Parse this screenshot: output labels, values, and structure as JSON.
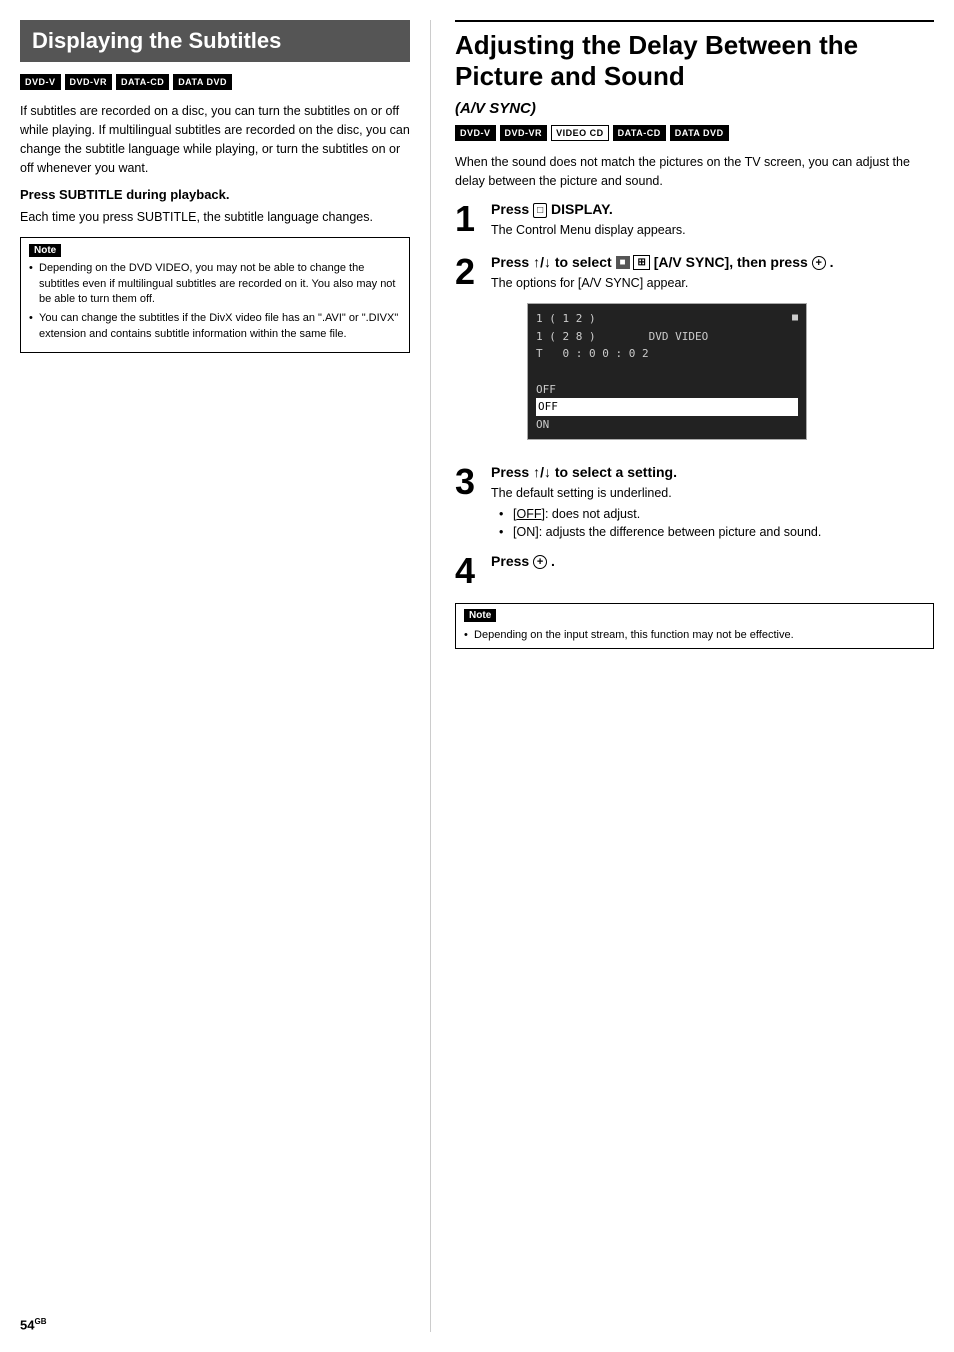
{
  "left": {
    "title": "Displaying the Subtitles",
    "badges": [
      {
        "label": "DVD-V",
        "style": "filled"
      },
      {
        "label": "DVD-VR",
        "style": "filled"
      },
      {
        "label": "DATA-CD",
        "style": "filled"
      },
      {
        "label": "DATA DVD",
        "style": "filled"
      }
    ],
    "intro": "If subtitles are recorded on a disc, you can turn the subtitles on or off while playing. If multilingual subtitles are recorded on the disc, you can change the subtitle language while playing, or turn the subtitles on or off whenever you want.",
    "subheading": "Press SUBTITLE during playback.",
    "subtext": "Each time you press SUBTITLE, the subtitle language changes.",
    "note_label": "Note",
    "note_items": [
      "Depending on the DVD VIDEO, you may not be able to change the subtitles even if multilingual subtitles are recorded on it. You also may not be able to turn them off.",
      "You can change the subtitles if the DivX video file has an \".AVI\" or \".DIVX\" extension and contains subtitle information within the same file."
    ]
  },
  "right": {
    "title": "Adjusting the Delay Between the Picture and Sound",
    "av_sync_label": "(A/V SYNC)",
    "badges": [
      {
        "label": "DVD-V",
        "style": "filled"
      },
      {
        "label": "DVD-VR",
        "style": "filled"
      },
      {
        "label": "VIDEO CD",
        "style": "outline"
      },
      {
        "label": "DATA-CD",
        "style": "filled"
      },
      {
        "label": "DATA DVD",
        "style": "filled"
      }
    ],
    "intro": "When the sound does not match the pictures on the TV screen, you can adjust the delay between the picture and sound.",
    "steps": [
      {
        "number": "1",
        "title": "Press  DISPLAY.",
        "desc": "The Control Menu display appears."
      },
      {
        "number": "2",
        "title": "Press ↑/↓ to select  [A/V SYNC], then press .",
        "title_parts": {
          "pre": "Press ",
          "arrows": "↑/↓",
          "mid": " to select ",
          "icon1": "■",
          "icon2": "⊞",
          "post": " [A/V SYNC], then press ",
          "circle": "⊕",
          "end": " ."
        },
        "desc": "The options for [A/V SYNC] appear."
      },
      {
        "number": "3",
        "title": "Press ↑/↓ to select a setting.",
        "desc": "The default setting is underlined.",
        "bullets": [
          "[OFF]: does not adjust.",
          "[ON]: adjusts the difference between picture and sound."
        ]
      },
      {
        "number": "4",
        "title": "Press .",
        "desc": ""
      }
    ],
    "screen": {
      "line1": "1 ( 1 2 )",
      "line2": "1 ( 2 8 )",
      "line3": "T   0 : 0 0 : 0 2",
      "line4": "",
      "line5": "OFF",
      "line6_highlight": "OFF",
      "line7": "ON",
      "dvd_label": "DVD VIDEO"
    },
    "note_label": "Note",
    "note_items": [
      "Depending on the input stream, this function may not be effective."
    ]
  },
  "page_number": "54",
  "page_suffix": "GB"
}
